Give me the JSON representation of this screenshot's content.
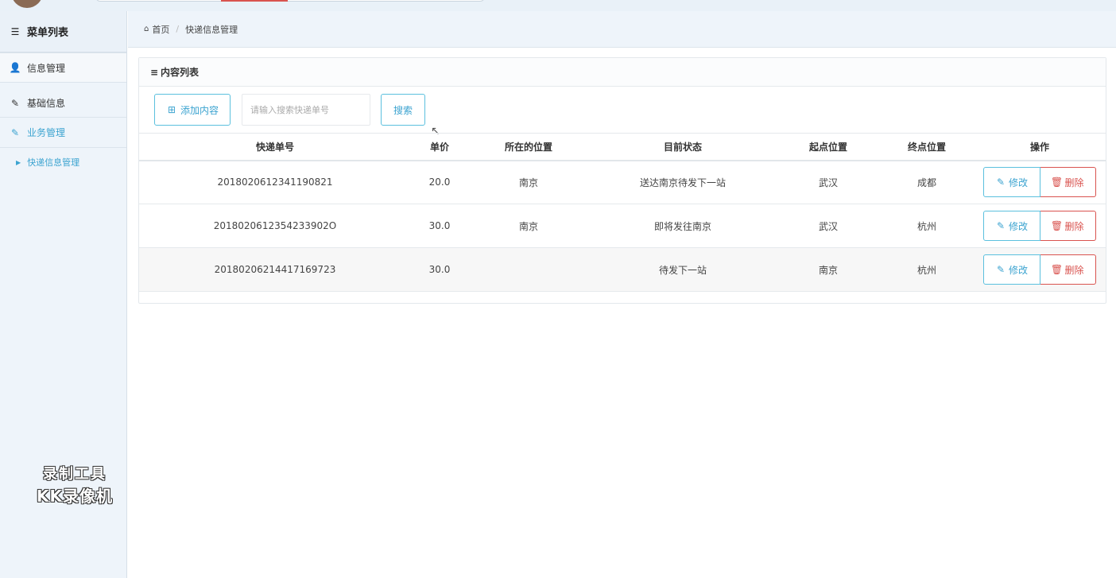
{
  "sidebar": {
    "menu_title": "菜单列表",
    "items": [
      {
        "label": "信息管理"
      },
      {
        "label": "基础信息"
      },
      {
        "label": "业务管理"
      }
    ],
    "sub_item": "快递信息管理"
  },
  "watermark": {
    "line1": "录制工具",
    "line2": "KK录像机"
  },
  "breadcrumb": {
    "home": "首页",
    "current": "快递信息管理"
  },
  "panel": {
    "title": "内容列表"
  },
  "toolbar": {
    "add_label": "添加内容",
    "search_placeholder": "请输入搜索快递单号",
    "search_label": "搜索"
  },
  "table": {
    "headers": [
      "快递单号",
      "单价",
      "所在的位置",
      "目前状态",
      "起点位置",
      "终点位置",
      "操作"
    ],
    "rows": [
      {
        "no": "2018020612341190821",
        "price": "20.0",
        "location": "南京",
        "status": "送达南京待发下一站",
        "start": "武汉",
        "end": "成都"
      },
      {
        "no": "2018020612354233902O",
        "price": "30.0",
        "location": "南京",
        "status": "即将发往南京",
        "start": "武汉",
        "end": "杭州"
      },
      {
        "no": "20180206214417169723",
        "price": "30.0",
        "location": "",
        "status": "待发下一站",
        "start": "南京",
        "end": "杭州"
      }
    ],
    "edit_label": "修改",
    "delete_label": "删除"
  },
  "colors": {
    "accent": "#3ba3d0",
    "danger": "#d9534f",
    "sidebar_bg": "#eef4fa"
  },
  "icons": [
    "list-icon",
    "user-icon",
    "edit-icon",
    "home-icon",
    "plus-square-icon",
    "trash-icon",
    "caret-right-icon"
  ]
}
